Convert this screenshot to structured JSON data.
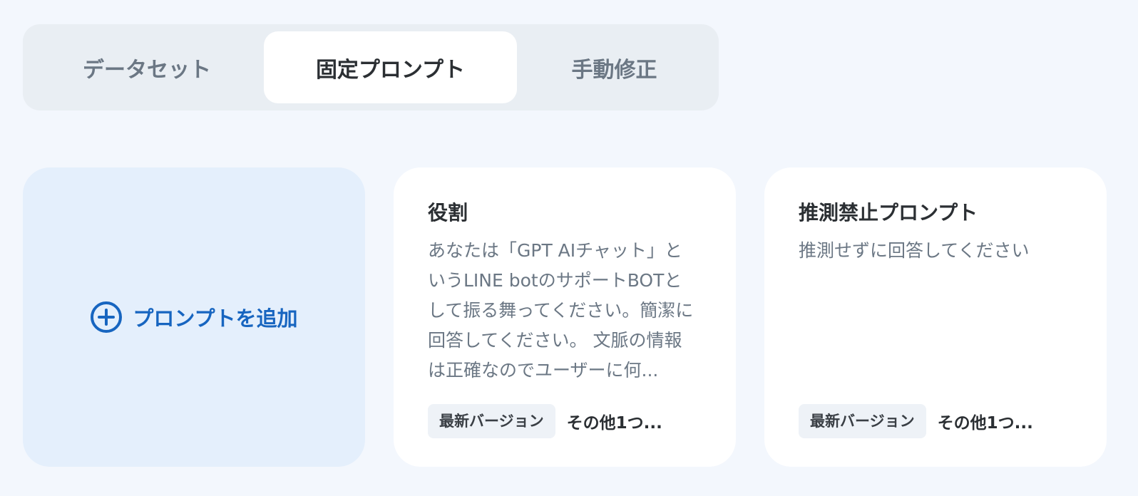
{
  "tabs": [
    {
      "label": "データセット"
    },
    {
      "label": "固定プロンプト",
      "active": true
    },
    {
      "label": "手動修正"
    }
  ],
  "add_card": {
    "label": "プロンプトを追加",
    "icon": "plus-circle-icon",
    "accent": "#1765c0"
  },
  "prompts": [
    {
      "title": "役割",
      "body": "あなたは「GPT AIチャット」というLINE botのサポートBOTとして振る舞ってください。簡潔に回答してください。 文脈の情報は正確なのでユーザーに何...",
      "badge": "最新バージョン",
      "more": "その他1つ..."
    },
    {
      "title": "推測禁止プロンプト",
      "body": "推測せずに回答してください",
      "badge": "最新バージョン",
      "more": "その他1つ..."
    }
  ]
}
